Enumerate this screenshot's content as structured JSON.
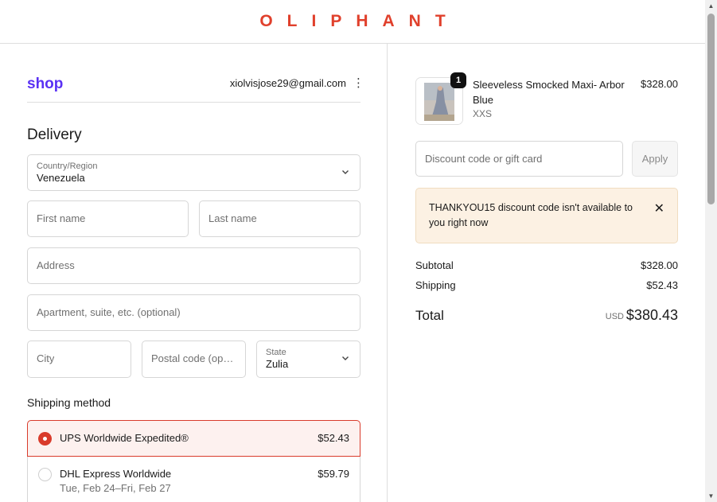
{
  "header": {
    "brand": "OLIPHANT"
  },
  "account": {
    "shop_logo": "shop",
    "email": "xiolvisjose29@gmail.com",
    "menu_icon": "more-vertical-icon"
  },
  "delivery": {
    "title": "Delivery",
    "country": {
      "label": "Country/Region",
      "value": "Venezuela"
    },
    "first_name": {
      "placeholder": "First name"
    },
    "last_name": {
      "placeholder": "Last name"
    },
    "address": {
      "placeholder": "Address"
    },
    "apartment": {
      "placeholder": "Apartment, suite, etc. (optional)"
    },
    "city": {
      "placeholder": "City"
    },
    "postal": {
      "placeholder": "Postal code (optional)"
    },
    "state": {
      "label": "State",
      "value": "Zulia"
    }
  },
  "shipping": {
    "title": "Shipping method",
    "options": [
      {
        "name": "UPS Worldwide Expedited®",
        "price": "$52.43",
        "selected": true
      },
      {
        "name": "DHL Express Worldwide",
        "sub": "Tue, Feb 24–Fri, Feb 27",
        "price": "$59.79",
        "selected": false
      }
    ]
  },
  "cart": {
    "quantity": "1",
    "product_name": "Sleeveless Smocked Maxi- Arbor Blue",
    "variant": "XXS",
    "price": "$328.00"
  },
  "discount": {
    "placeholder": "Discount code or gift card",
    "apply_label": "Apply",
    "notice": "THANKYOU15 discount code isn't available to you right now"
  },
  "summary": {
    "subtotal_label": "Subtotal",
    "subtotal": "$328.00",
    "shipping_label": "Shipping",
    "shipping": "$52.43",
    "total_label": "Total",
    "currency": "USD",
    "total": "$380.43"
  },
  "colors": {
    "brand": "#e0402c",
    "shop": "#5a31f4",
    "accent": "#d93b2b",
    "notice_bg": "#fcf1e3"
  }
}
